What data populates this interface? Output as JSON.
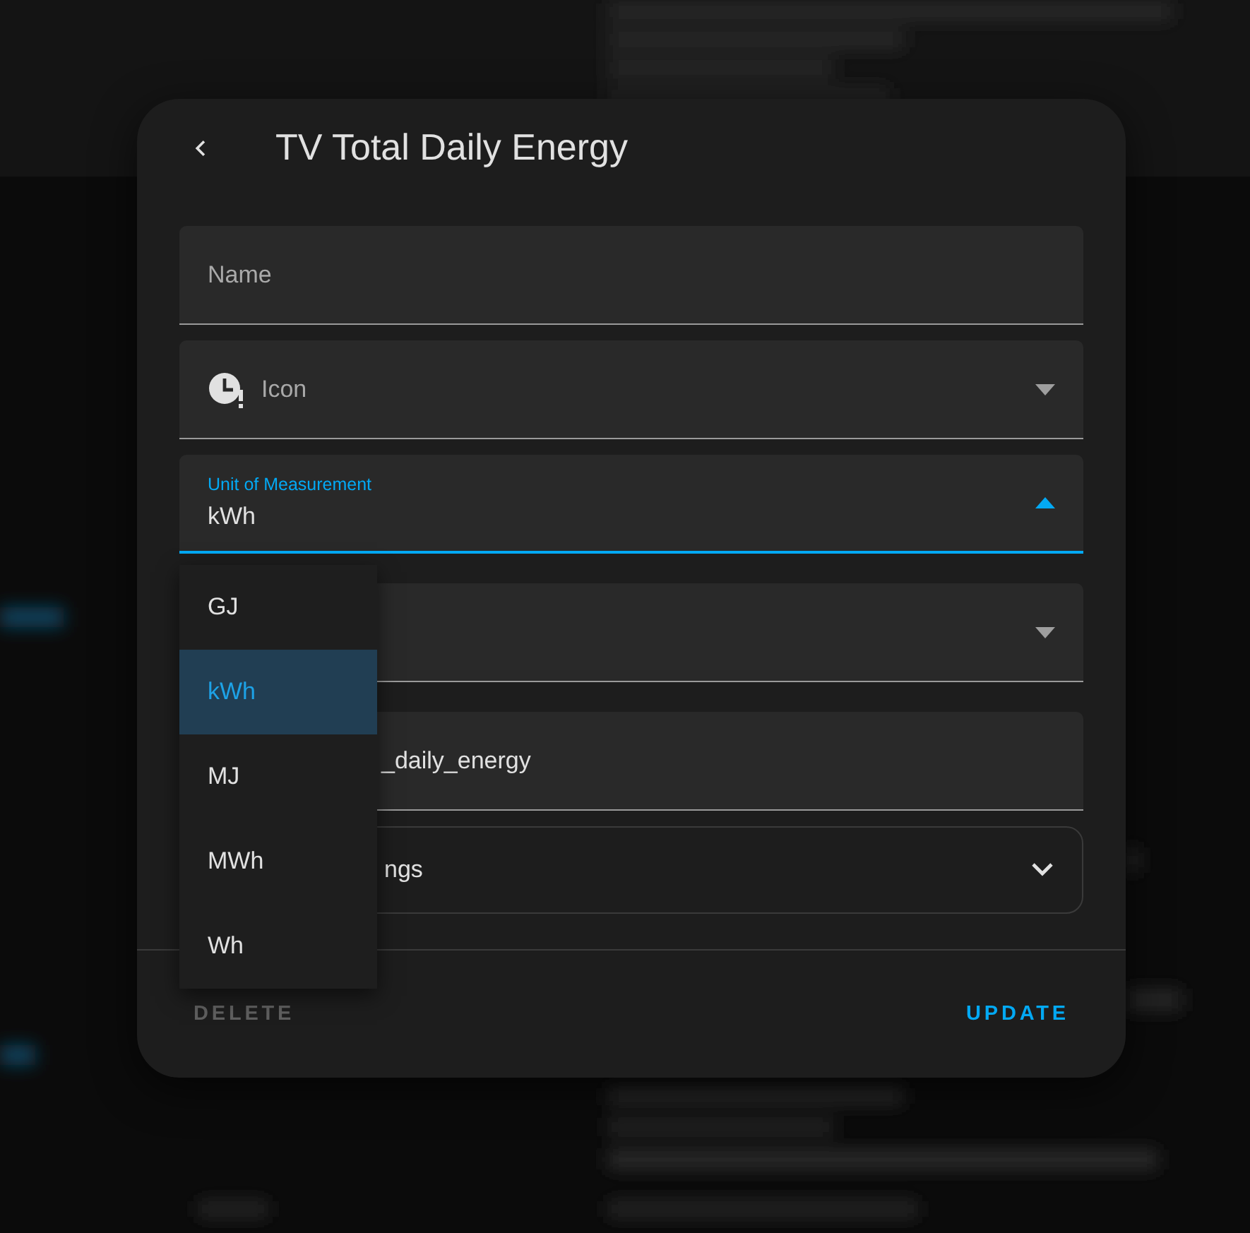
{
  "dialog": {
    "title": "TV Total Daily Energy",
    "fields": [
      {
        "kind": "text",
        "label": "Name"
      },
      {
        "kind": "icon-picker",
        "label": "Icon",
        "expanded": false
      },
      {
        "kind": "select",
        "label": "Unit of Measurement",
        "value": "kWh",
        "focused": true,
        "expanded": true
      },
      {
        "kind": "select",
        "expanded": false
      },
      {
        "kind": "text",
        "value": "_daily_energy"
      },
      {
        "kind": "expander",
        "label": "ngs",
        "expanded": false
      }
    ],
    "menu": {
      "items": [
        {
          "label": "GJ",
          "selected": false
        },
        {
          "label": "kWh",
          "selected": true
        },
        {
          "label": "MJ",
          "selected": false
        },
        {
          "label": "MWh",
          "selected": false
        },
        {
          "label": "Wh",
          "selected": false
        }
      ]
    },
    "buttons": [
      {
        "label": "DELETE",
        "disabled": true
      },
      {
        "label": "UPDATE",
        "disabled": false
      }
    ]
  }
}
